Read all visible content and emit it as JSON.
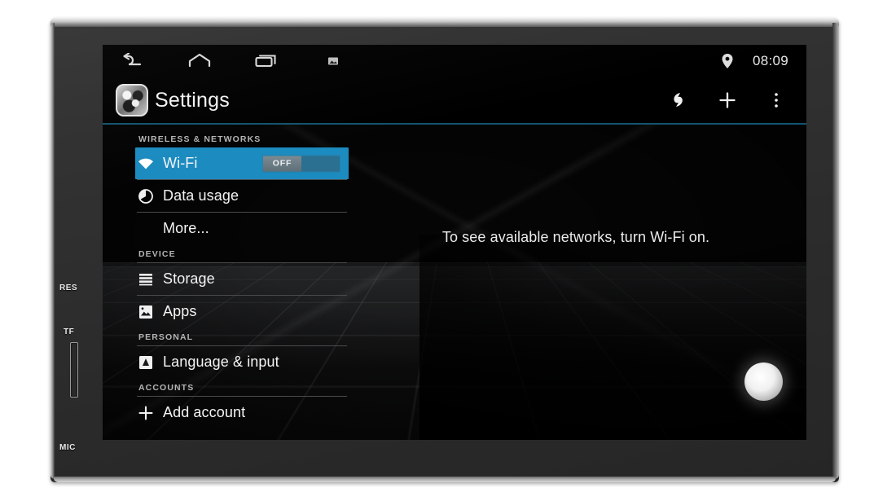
{
  "device": {
    "side_labels": [
      {
        "name": "reset",
        "text": "RES"
      },
      {
        "name": "tf-card-slot",
        "text": "TF"
      },
      {
        "name": "microphone",
        "text": "MIC"
      }
    ]
  },
  "status_bar": {
    "nav_icons": [
      {
        "name": "back-icon",
        "glyph": "back"
      },
      {
        "name": "home-icon",
        "glyph": "home"
      },
      {
        "name": "recents-icon",
        "glyph": "recents"
      },
      {
        "name": "screenshot-icon",
        "glyph": "screenshot"
      }
    ],
    "location_icon": "location-pin-icon",
    "time": "08:09"
  },
  "action_bar": {
    "app_icon": "settings-app-icon",
    "title": "Settings",
    "actions": [
      {
        "name": "sync-icon",
        "glyph": "sync"
      },
      {
        "name": "add-icon",
        "glyph": "plus"
      },
      {
        "name": "overflow-menu-icon",
        "glyph": "overflow"
      }
    ]
  },
  "settings": {
    "sections": [
      {
        "header": "WIRELESS & NETWORKS",
        "items": [
          {
            "name": "wifi",
            "label": "Wi-Fi",
            "icon": "wifi-icon",
            "selected": true,
            "toggle": {
              "state": "OFF",
              "on": false
            }
          },
          {
            "name": "data-usage",
            "label": "Data usage",
            "icon": "data-usage-icon",
            "selected": false
          },
          {
            "name": "more",
            "label": "More...",
            "icon": null,
            "selected": false
          }
        ]
      },
      {
        "header": "DEVICE",
        "items": [
          {
            "name": "storage",
            "label": "Storage",
            "icon": "storage-icon",
            "selected": false
          },
          {
            "name": "apps",
            "label": "Apps",
            "icon": "apps-icon",
            "selected": false
          }
        ]
      },
      {
        "header": "PERSONAL",
        "items": [
          {
            "name": "language-input",
            "label": "Language & input",
            "icon": "language-icon",
            "selected": false
          }
        ]
      },
      {
        "header": "ACCOUNTS",
        "items": [
          {
            "name": "add-account",
            "label": "Add account",
            "icon": "plus-icon",
            "selected": false
          }
        ]
      }
    ]
  },
  "main": {
    "empty_message": "To see available networks, turn Wi-Fi on."
  },
  "colors": {
    "accent_blue": "#1b8bc0",
    "divider_blue": "#11536e",
    "screen_black": "#000000",
    "text_primary": "#f4f4f4",
    "text_secondary": "#b4b4b4"
  }
}
